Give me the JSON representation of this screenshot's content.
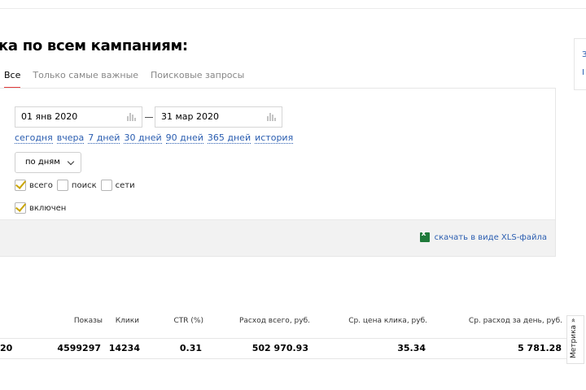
{
  "page": {
    "title": "ка по всем кампаниям:"
  },
  "tabs": [
    {
      "label": "Все",
      "active": true
    },
    {
      "label": "Только самые важные",
      "active": false
    },
    {
      "label": "Поисковые запросы",
      "active": false
    }
  ],
  "filters": {
    "date_from": "01 янв 2020",
    "date_to": "31 мар 2020",
    "quick_ranges": [
      "сегодня",
      "вчера",
      "7 дней",
      "30 дней",
      "90 дней",
      "365 дней",
      "история"
    ],
    "group_by": "по дням",
    "platform_checkboxes": [
      {
        "label": "всего",
        "checked": true
      },
      {
        "label": "поиск",
        "checked": false
      },
      {
        "label": "сети",
        "checked": false
      }
    ],
    "status_checkbox": {
      "label": "включен",
      "checked": true
    },
    "download_label": "скачать в виде XLS-файла"
  },
  "side_card": {
    "lines": [
      "З",
      "I"
    ]
  },
  "table": {
    "headers": [
      "Показы",
      "Клики",
      "CTR (%)",
      "Расход всего, руб.",
      "Ср. цена клика, руб.",
      "Ср. расход за день, руб."
    ],
    "row": {
      "first_cell": "20",
      "values": [
        "4599297",
        "14234",
        "0.31",
        "502 970.93",
        "35.34",
        "5 781.28"
      ]
    }
  },
  "metrika_tab": {
    "label": "Метрика »"
  },
  "colors": {
    "link": "#2a5db0",
    "active_tab_underline": "#e23a3a",
    "checkmark": "#c9a400",
    "xls_icon": "#1f7a3a"
  }
}
